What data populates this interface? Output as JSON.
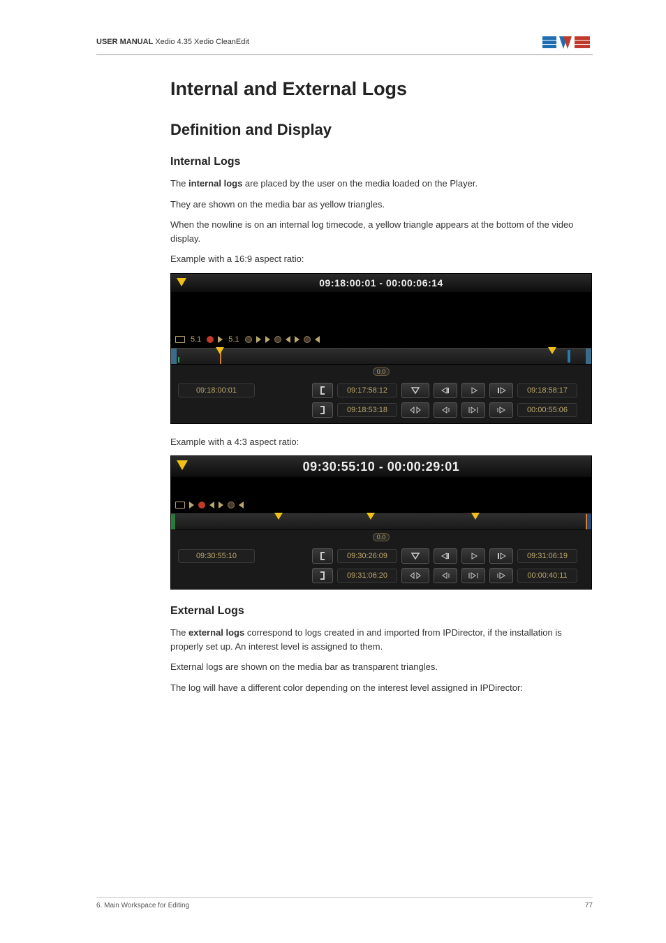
{
  "header": {
    "manual_prefix": "USER MANUAL",
    "product": " Xedio 4.35",
    "module": " Xedio CleanEdit"
  },
  "logo": {
    "name": "evs-logo"
  },
  "section": {
    "h1": "Internal and External Logs",
    "h2": "Definition and Display",
    "internal": {
      "h3": "Internal Logs",
      "p1a": "The ",
      "p1b": "internal logs",
      "p1c": " are placed by the user on the media loaded on the Player.",
      "p2": "They are shown on the media bar as yellow triangles.",
      "p3": "When the nowline is on an internal log timecode, a yellow triangle appears at the bottom of the video display.",
      "p4": "Example with a 16:9 aspect ratio:"
    },
    "panel169": {
      "tc_main": "09:18:00:01  -  00:00:06:14",
      "audio_a": "5.1",
      "audio_b": "5.1",
      "zoom": "0.0",
      "tc_now": "09:18:00:01",
      "tc_in": "09:17:58:12",
      "tc_out": "09:18:58:17",
      "tc_in2": "09:18:53:18",
      "tc_out2": "00:00:55:06"
    },
    "mid_caption": "Example with a 4:3 aspect ratio:",
    "panel43": {
      "tc_main": "09:30:55:10  -  00:00:29:01",
      "zoom": "0.0",
      "tc_now": "09:30:55:10",
      "tc_in": "09:30:26:09",
      "tc_out": "09:31:06:19",
      "tc_in2": "09:31:06:20",
      "tc_out2": "00:00:40:11"
    },
    "external": {
      "h3": "External Logs",
      "p1a": "The ",
      "p1b": "external logs",
      "p1c": " correspond to logs created in and imported from IPDirector, if the installation is properly set up. An interest level is assigned to them.",
      "p2": "External logs are shown on the media bar as transparent triangles.",
      "p3": "The log will have a different color depending on the interest level assigned in IPDirector:"
    }
  },
  "footer": {
    "chapter": "6. Main Workspace for Editing",
    "page": "77"
  }
}
